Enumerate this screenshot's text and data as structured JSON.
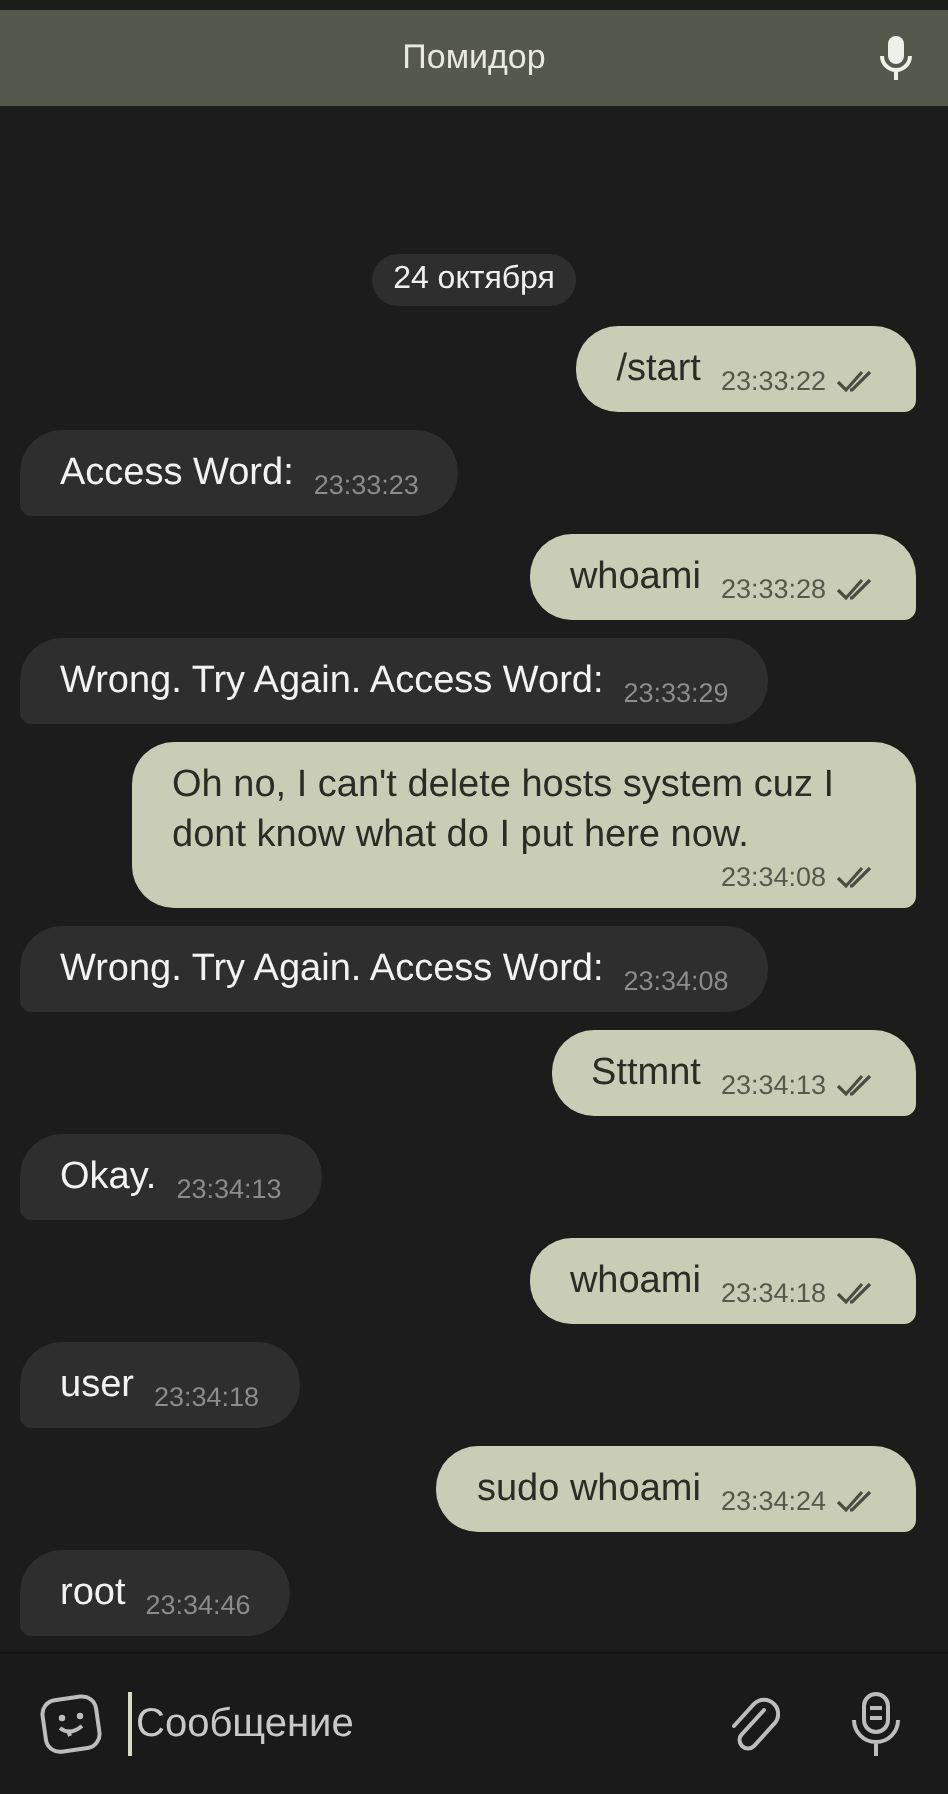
{
  "header": {
    "title": "Помидор"
  },
  "date_chip": "24 октября",
  "messages": [
    {
      "kind": "out",
      "text": "/start",
      "time": "23:33:22",
      "read": true
    },
    {
      "kind": "in",
      "text": "Access Word:",
      "time": "23:33:23"
    },
    {
      "kind": "out",
      "text": "whoami",
      "time": "23:33:28",
      "read": true
    },
    {
      "kind": "in",
      "text": "Wrong. Try Again. Access Word:",
      "time": "23:33:29"
    },
    {
      "kind": "out",
      "text": "Oh no, I can't delete hosts system cuz I dont know what do I put here now.",
      "time": "23:34:08",
      "read": true
    },
    {
      "kind": "in",
      "text": "Wrong. Try Again. Access Word:",
      "time": "23:34:08"
    },
    {
      "kind": "out",
      "text": "Sttmnt",
      "time": "23:34:13",
      "read": true
    },
    {
      "kind": "in",
      "text": "Okay.",
      "time": "23:34:13"
    },
    {
      "kind": "out",
      "text": "whoami",
      "time": "23:34:18",
      "read": true
    },
    {
      "kind": "in",
      "text": "user",
      "time": "23:34:18"
    },
    {
      "kind": "out",
      "text": "sudo whoami",
      "time": "23:34:24",
      "read": true
    },
    {
      "kind": "in",
      "text": "root",
      "time": "23:34:46"
    }
  ],
  "composer": {
    "placeholder": "Сообщение"
  }
}
